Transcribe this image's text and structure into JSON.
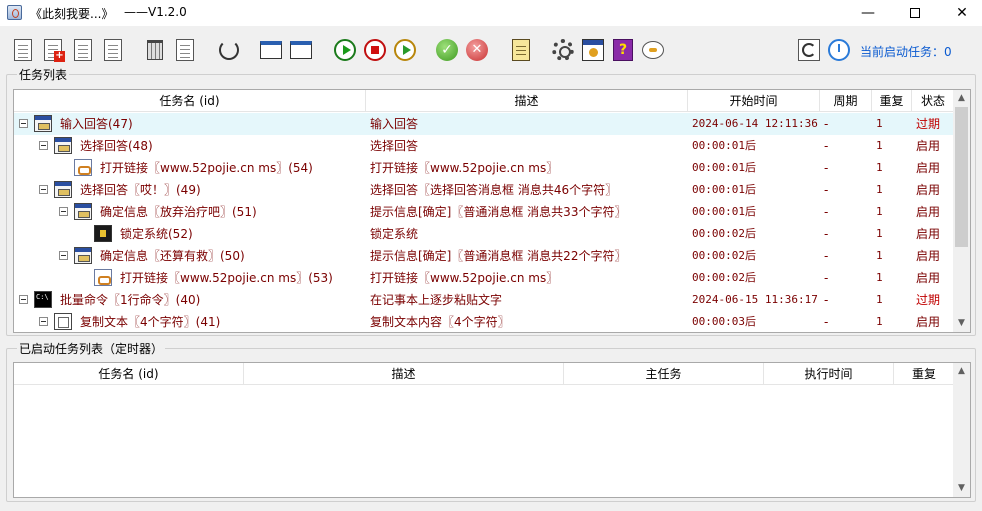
{
  "window": {
    "title": "《此刻我要...》",
    "version": "——V1.2.0",
    "minimize": "—",
    "close": "✕"
  },
  "toolbar": {
    "status_label": "当前启动任务：0"
  },
  "task_list": {
    "group_title": "任务列表",
    "columns": {
      "name": "任务名 (id)",
      "desc": "描述",
      "start": "开始时间",
      "period": "周期",
      "repeat": "重复",
      "status": "状态"
    },
    "rows": [
      {
        "name": "输入回答(47)",
        "desc": "输入回答",
        "start": "2024-06-14 12:11:36",
        "period": "-",
        "repeat": "1",
        "status": "过期",
        "icon": "dialog-icon"
      },
      {
        "name": "选择回答(48)",
        "desc": "选择回答",
        "start": "00:00:01后",
        "period": "-",
        "repeat": "1",
        "status": "启用",
        "icon": "dialog-icon"
      },
      {
        "name": "打开链接〖www.52pojie.cn ms〗(54)",
        "desc": "打开链接〖www.52pojie.cn ms〗",
        "start": "00:00:01后",
        "period": "-",
        "repeat": "1",
        "status": "启用",
        "icon": "link-icon"
      },
      {
        "name": "选择回答〖哎！〗(49)",
        "desc": "选择回答〖选择回答消息框 消息共46个字符〗",
        "start": "00:00:01后",
        "period": "-",
        "repeat": "1",
        "status": "启用",
        "icon": "dialog-icon"
      },
      {
        "name": "确定信息〖放弃治疗吧〗(51)",
        "desc": "提示信息[确定]〖普通消息框 消息共33个字符〗",
        "start": "00:00:01后",
        "period": "-",
        "repeat": "1",
        "status": "启用",
        "icon": "dialog-icon"
      },
      {
        "name": "锁定系统(52)",
        "desc": "锁定系统",
        "start": "00:00:02后",
        "period": "-",
        "repeat": "1",
        "status": "启用",
        "icon": "lock-screen-icon"
      },
      {
        "name": "确定信息〖还算有救〗(50)",
        "desc": "提示信息[确定]〖普通消息框 消息共22个字符〗",
        "start": "00:00:02后",
        "period": "-",
        "repeat": "1",
        "status": "启用",
        "icon": "dialog-icon"
      },
      {
        "name": "打开链接〖www.52pojie.cn ms〗(53)",
        "desc": "打开链接〖www.52pojie.cn ms〗",
        "start": "00:00:02后",
        "period": "-",
        "repeat": "1",
        "status": "启用",
        "icon": "link-icon"
      },
      {
        "name": "批量命令〖1行命令〗(40)",
        "desc": "在记事本上逐步粘贴文字",
        "start": "2024-06-15 11:36:17",
        "period": "-",
        "repeat": "1",
        "status": "过期",
        "icon": "cmd-icon"
      },
      {
        "name": "复制文本〖4个字符〗(41)",
        "desc": "复制文本内容〖4个字符〗",
        "start": "00:00:03后",
        "period": "-",
        "repeat": "1",
        "status": "启用",
        "icon": "copy-icon"
      }
    ]
  },
  "timer_list": {
    "group_title": "已启动任务列表（定时器）",
    "columns": {
      "name": "任务名 (id)",
      "desc": "描述",
      "main": "主任务",
      "exec": "执行时间",
      "repeat": "重复"
    }
  },
  "colors": {
    "row_text": "#7a0000",
    "expired_text": "#c00000",
    "status_accent": "#0a5ad0",
    "selected_row": "#e5f7fb"
  }
}
